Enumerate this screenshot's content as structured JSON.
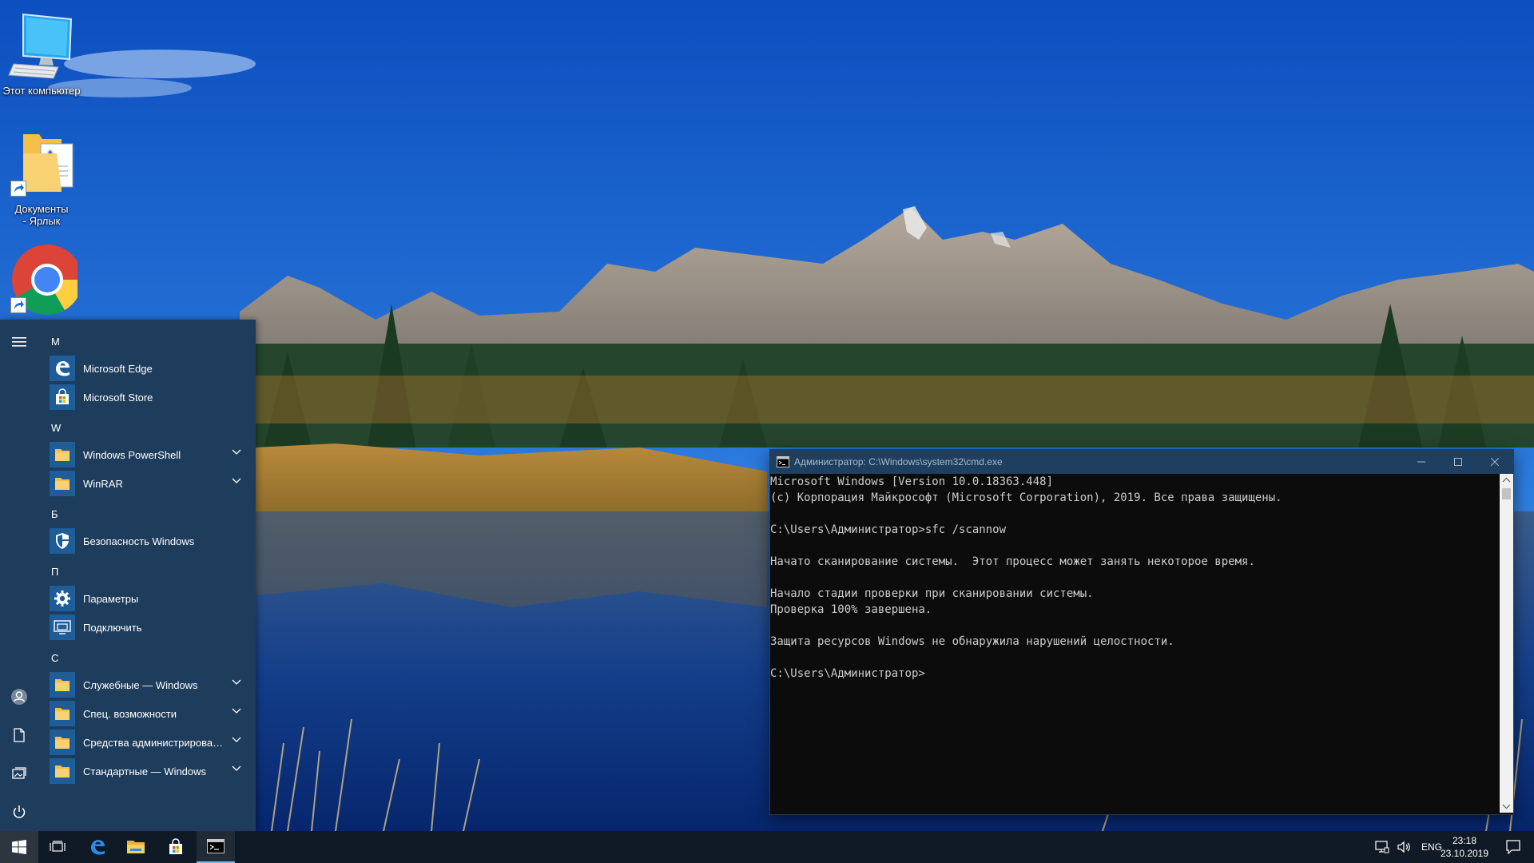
{
  "desktop": {
    "icons": [
      {
        "label": "Этот компьютер",
        "icon": "computer-icon"
      },
      {
        "label": "Документы - Ярлык",
        "icon": "documents-folder-icon"
      },
      {
        "label": "",
        "icon": "chrome-icon"
      }
    ]
  },
  "start_menu": {
    "rail": [
      "hamburger-menu-icon",
      "user-avatar-icon",
      "documents-icon",
      "pictures-icon",
      "power-icon"
    ],
    "groups": [
      {
        "letter": "M",
        "items": [
          {
            "label": "Microsoft Edge",
            "icon": "edge-icon",
            "expandable": false
          },
          {
            "label": "Microsoft Store",
            "icon": "store-icon",
            "expandable": false
          }
        ]
      },
      {
        "letter": "W",
        "items": [
          {
            "label": "Windows PowerShell",
            "icon": "folder-icon",
            "expandable": true
          },
          {
            "label": "WinRAR",
            "icon": "folder-icon",
            "expandable": true
          }
        ]
      },
      {
        "letter": "Б",
        "items": [
          {
            "label": "Безопасность Windows",
            "icon": "shield-icon",
            "expandable": false
          }
        ]
      },
      {
        "letter": "П",
        "items": [
          {
            "label": "Параметры",
            "icon": "gear-icon",
            "expandable": false
          },
          {
            "label": "Подключить",
            "icon": "connect-icon",
            "expandable": false
          }
        ]
      },
      {
        "letter": "С",
        "items": [
          {
            "label": "Служебные — Windows",
            "icon": "folder-icon",
            "expandable": true
          },
          {
            "label": "Спец. возможности",
            "icon": "folder-icon",
            "expandable": true
          },
          {
            "label": "Средства администрирования...",
            "icon": "folder-icon",
            "expandable": true
          },
          {
            "label": "Стандартные — Windows",
            "icon": "folder-icon",
            "expandable": true
          }
        ]
      }
    ]
  },
  "console": {
    "title": "Администратор: C:\\Windows\\system32\\cmd.exe",
    "lines": [
      "Microsoft Windows [Version 10.0.18363.448]",
      "(c) Корпорация Майкрософт (Microsoft Corporation), 2019. Все права защищены.",
      "",
      "C:\\Users\\Администратор>sfc /scannow",
      "",
      "Начато сканирование системы.  Этот процесс может занять некоторое время.",
      "",
      "Начало стадии проверки при сканировании системы.",
      "Проверка 100% завершена.",
      "",
      "Защита ресурсов Windows не обнаружила нарушений целостности.",
      "",
      "C:\\Users\\Администратор>"
    ]
  },
  "taskbar": {
    "pinned": [
      "start-icon",
      "task-view-icon",
      "edge-icon",
      "file-explorer-icon",
      "store-icon",
      "cmd-icon"
    ],
    "language": "ENG",
    "time": "23:18",
    "date": "23.10.2019"
  },
  "colors": {
    "start_bg": "#1e3c5c",
    "tile_blue": "#1f5d99",
    "console_bg": "#0c0c0c",
    "console_text": "#cccccc",
    "taskbar_bg": "#0f1a26",
    "accent": "#76b9ed"
  }
}
